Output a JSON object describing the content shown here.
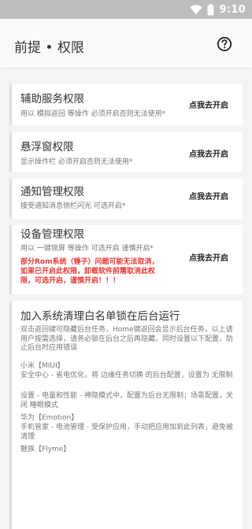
{
  "status_bar": {
    "time": "9:10"
  },
  "header": {
    "title": "前提 • 权限"
  },
  "permissions": [
    {
      "title": "辅助服务权限",
      "desc": "用以 模拟返回 等操作  必须开启否则无法使用*",
      "action": "点我去开启"
    },
    {
      "title": "悬浮窗权限",
      "desc": "显示操作栏  必须开启否则无法使用*",
      "action": "点我去开启"
    },
    {
      "title": "通知管理权限",
      "desc": "接受通知消息侧栏闪光  可选开启*",
      "action": "点我去开启"
    },
    {
      "title": "设备管理权限",
      "desc": "用以 一键锁屏 等操作  可选开启  谨慎开启*",
      "action": "点我去开启",
      "warning": "部分Rom系统（锤子）问题可能无法取消，如果已开启此权限，卸载软件前需取消此权限，可选开启，谨慎开启！！！"
    }
  ],
  "whitelist": {
    "title": "加入系统清理白名单锁在后台运行",
    "intro": "双击返回键可隐藏后台任务，Home键返回会显示后台任务，以上请用户按需选择，请务必锁在后台之后再隐藏。同时设置以下配置，防止后台时应用错误",
    "sections": [
      {
        "brand": "小米【MIUI】",
        "lines": [
          "安全中心 - 省电优化，将 边缘任务切换 的后台配置，设置为 无限制",
          "设置 - 电量和性能 - 神隐模式中，配置为后台无限制；场景配置，关闭 睡眠模式"
        ]
      },
      {
        "brand": "华为【Emotion】",
        "lines": [
          "手机管家 - 电池管理 - 受保护应用，手动把应用加到此列表，避免被清理"
        ]
      },
      {
        "brand": "魅族【Flyme】",
        "lines": []
      }
    ]
  }
}
